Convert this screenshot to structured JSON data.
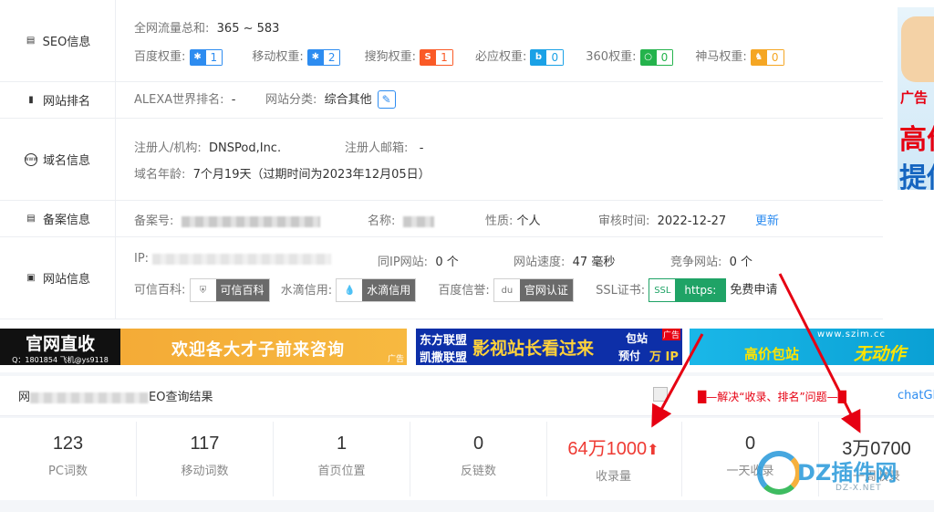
{
  "seo": {
    "label": "SEO信息",
    "traffic_label": "全网流量总和:",
    "traffic_value": "365 ~ 583",
    "weights": [
      {
        "label": "百度权重:",
        "value": "1",
        "color": "#2d8cf0"
      },
      {
        "label": "移动权重:",
        "value": "2",
        "color": "#2d8cf0"
      },
      {
        "label": "搜狗权重:",
        "value": "1",
        "color": "#fa5a26"
      },
      {
        "label": "必应权重:",
        "value": "0",
        "color": "#1aa1e6"
      },
      {
        "label": "360权重:",
        "value": "0",
        "color": "#24b34c"
      },
      {
        "label": "神马权重:",
        "value": "0",
        "color": "#f5a623"
      }
    ]
  },
  "ranking": {
    "label": "网站排名",
    "alexa_label": "ALEXA世界排名:",
    "alexa_value": "-",
    "category_label": "网站分类:",
    "category_value": "综合其他"
  },
  "domain": {
    "label": "域名信息",
    "registrant_label": "注册人/机构:",
    "registrant_value": "DNSPod,Inc.",
    "email_label": "注册人邮箱:",
    "email_value": "-",
    "age_label": "域名年龄:",
    "age_value": "7个月19天（过期时间为2023年12月05日）"
  },
  "icp": {
    "label": "备案信息",
    "number_label": "备案号:",
    "name_label": "名称:",
    "nature_label": "性质:",
    "nature_value": "个人",
    "audit_label": "审核时间:",
    "audit_value": "2022-12-27",
    "update_link": "更新"
  },
  "site": {
    "label": "网站信息",
    "ip_label": "IP:",
    "same_ip_label": "同IP网站:",
    "same_ip_value": "0 个",
    "speed_label": "网站速度:",
    "speed_value": "47 毫秒",
    "competitor_label": "竞争网站:",
    "competitor_value": "0 个",
    "certs": [
      {
        "label": "可信百科:",
        "badge": "可信百科",
        "icon": "shield-icon",
        "color": "#6a6a6a"
      },
      {
        "label": "水滴信用:",
        "badge": "水滴信用",
        "icon": "drop-icon",
        "color": "#6a6a6a"
      },
      {
        "label": "百度信誉:",
        "badge": "官网认证",
        "icon": "baidu-paw-icon",
        "color": "#6a6a6a"
      }
    ],
    "ssl_label": "SSL证书:",
    "ssl_badge": "https:",
    "ssl_apply": "免费申请"
  },
  "ads": [
    {
      "big": "官网直收",
      "sub": "Q：1801854 飞机@ys9118",
      "slogan": "欢迎各大才子前来咨询",
      "tag": "广告"
    },
    {
      "left1": "东方联盟",
      "left2": "凯撒联盟",
      "slogan": "影视站长看过来",
      "r1": "包站",
      "r2": "预付",
      "r3": "万 IP",
      "tag": "广告"
    },
    {
      "url": "www.szim.cc",
      "left": "高价包站",
      "right": "无动作"
    }
  ],
  "side_ad": {
    "tag": "广告",
    "big1": "高价",
    "big2": "提供"
  },
  "query": {
    "title_left": "网",
    "title_right": "EO查询结果",
    "promo": "█—解决“收录、排名”问题—█",
    "chat_link": "chatGPT"
  },
  "stats": [
    {
      "value": "123",
      "label": "PC词数"
    },
    {
      "value": "117",
      "label": "移动词数"
    },
    {
      "value": "1",
      "label": "首页位置"
    },
    {
      "value": "0",
      "label": "反链数"
    },
    {
      "value": "64万1000",
      "label": "收录量",
      "arrow": "⬆"
    },
    {
      "value": "0",
      "label": "一天收录"
    },
    {
      "value": "3万0700",
      "label": "一周收录"
    }
  ],
  "watermark": {
    "text": "DZ插件网",
    "sub": "DZ-X.NET"
  }
}
